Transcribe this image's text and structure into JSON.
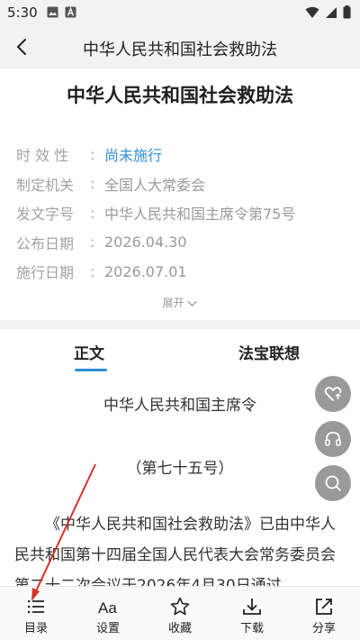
{
  "status_bar": {
    "time": "5:30"
  },
  "header": {
    "title": "中华人民共和国社会救助法"
  },
  "document": {
    "title": "中华人民共和国社会救助法",
    "meta": [
      {
        "label": "时 效 性",
        "value": "尚未施行",
        "highlight": true
      },
      {
        "label": "制定机关",
        "value": "全国人大常委会",
        "highlight": false
      },
      {
        "label": "发文字号",
        "value": "中华人民共和国主席令第75号",
        "highlight": false
      },
      {
        "label": "公布日期",
        "value": "2026.04.30",
        "highlight": false
      },
      {
        "label": "施行日期",
        "value": "2026.07.01",
        "highlight": false
      }
    ],
    "separator": ":",
    "expand_label": "展开"
  },
  "tabs": [
    {
      "label": "正文",
      "active": true
    },
    {
      "label": "法宝联想",
      "active": false
    }
  ],
  "body": {
    "order_title": "中华人民共和国主席令",
    "order_number": "（第七十五号）",
    "paragraph": "《中华人民共和国社会救助法》已由中华人民共和国第十四届全国人民代表大会常务委员会第二十二次会议于2026年4月30日通过"
  },
  "floating_buttons": [
    "heart-refresh-icon",
    "headphones-icon",
    "search-icon"
  ],
  "bottom_nav": [
    {
      "label": "目录",
      "icon": "list-icon"
    },
    {
      "label": "设置",
      "icon": "font-size-icon"
    },
    {
      "label": "收藏",
      "icon": "star-icon"
    },
    {
      "label": "下载",
      "icon": "download-icon"
    },
    {
      "label": "分享",
      "icon": "share-icon"
    }
  ],
  "colors": {
    "accent": "#2f8fd8",
    "header_bg": "#f2f2f2",
    "annotation": "#d9302b"
  }
}
